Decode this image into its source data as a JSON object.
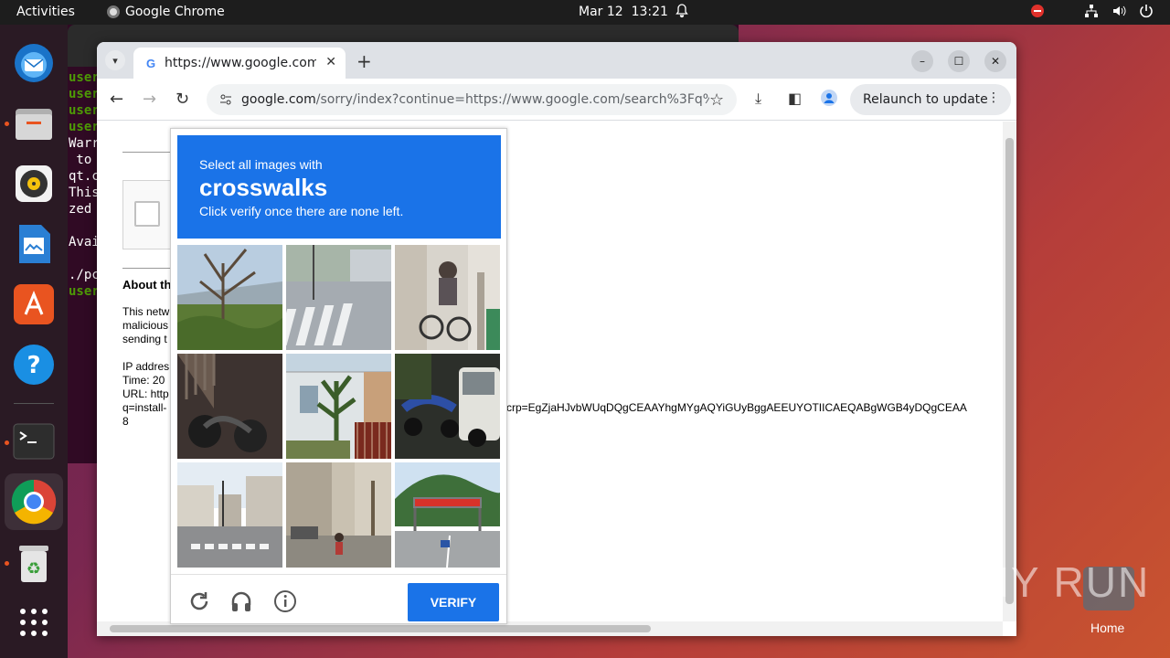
{
  "topbar": {
    "activities": "Activities",
    "app_name": "Google Chrome",
    "date": "Mar 12",
    "time": "13:21"
  },
  "dock": {
    "items": [
      "thunderbird",
      "files",
      "rhythmbox",
      "libreoffice-writer",
      "app-center",
      "help",
      "terminal",
      "chrome",
      "trash",
      "show-apps"
    ]
  },
  "terminal": {
    "lines": [
      "user",
      "user",
      "user",
      "user",
      "Warr",
      " to",
      "qt.c",
      "This",
      "zed",
      "",
      "Avai",
      "",
      "./pc",
      "user"
    ]
  },
  "chrome": {
    "tab_title": "https://www.google.com",
    "url_host": "google.com",
    "url_rest": "/sorry/index?continue=https://www.google.com/search%3Fq%3Di...",
    "relaunch_label": "Relaunch to update"
  },
  "page": {
    "about_heading": "About th",
    "para_line1": "This netw",
    "para_line2": "malicious",
    "para_line3": "sending t",
    "ip_line": "IP addres",
    "time_line": "Time: 20",
    "url_line": "URL: http",
    "q_line": "q=install-",
    "num_line": "8",
    "long_fragment": "crp=EgZjaHJvbWUqDQgCEAAYhgMYgAQYiGUyBggAEEUYOTIICAEQABgWGB4yDQgCEAA"
  },
  "captcha": {
    "instruction_line1": "Select all images with",
    "target": "crosswalks",
    "instruction_line3": "Click verify once there are none left.",
    "verify_label": "VERIFY",
    "tiles": [
      "tree-grass",
      "crosswalk-road",
      "cyclist-street",
      "motorcycle-night",
      "house-porch",
      "scooter-van",
      "crosswalk-intersection",
      "street-cyclist",
      "highway-gantry"
    ]
  },
  "desktop": {
    "watermark": "ANY RUN",
    "home_label": "Home"
  }
}
